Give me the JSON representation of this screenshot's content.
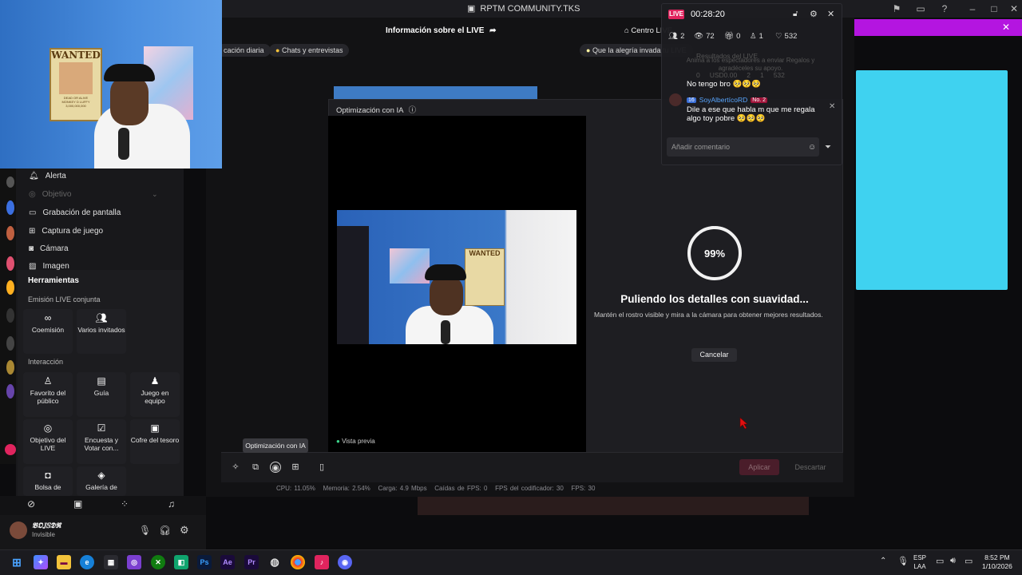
{
  "window": {
    "title": "RPTM COMMUNITY.TKS"
  },
  "studio": {
    "live_info_label": "Información sobre el LIVE",
    "centro_live_label": "Centro LIVE",
    "chips": [
      "cación diaria",
      "Chats y entrevistas",
      "Que la alegría invada tu LIVE"
    ]
  },
  "webcam": {
    "poster_text": "WANTED",
    "poster_sub": "DEAD OR ALIVE",
    "poster_name": "MONKEY D LUFFY",
    "poster_bounty": "3,000,000,000"
  },
  "left_panel": {
    "sources": [
      "Alerta",
      "Objetivo",
      "Grabación de pantalla",
      "Captura de juego",
      "Cámara",
      "Imagen"
    ],
    "tools_title": "Herramientas",
    "joint_label": "Emisión LIVE conjunta",
    "joint_tools": [
      "Coemisión",
      "Varios invitados"
    ],
    "interaction_label": "Interacción",
    "interaction_tools": [
      "Favorito del público",
      "Guía",
      "Juego en equipo",
      "Objetivo del LIVE",
      "Encuesta y Votar con...",
      "Cofre del tesoro",
      "Bolsa de",
      "Galería de"
    ]
  },
  "modal": {
    "header": "Optimización con IA",
    "progress_text": "99%",
    "progress_value": 0.99,
    "status_title": "Puliendo los detalles con suavidad...",
    "status_desc": "Mantén el rostro visible y mira a la cámara para obtener mejores resultados.",
    "cancel_label": "Cancelar",
    "preview_label": "Vista previa",
    "apply_label": "Aplicar",
    "discard_label": "Descartar",
    "tooltip": "Optimización con IA"
  },
  "stats_bar": {
    "cpu": "CPU: 11.05%",
    "memoria": "Memoria: 2.54%",
    "carga": "Carga: 4.9 Mbps",
    "caidas": "Caídas de FPS: 0",
    "fps_cod": "FPS del codificador: 30",
    "fps": "FPS: 30"
  },
  "chat": {
    "live_badge": "LIVE",
    "timer": "00:28:20",
    "stats": {
      "users": "2",
      "views": "72",
      "gifts": "0",
      "followers": "1",
      "likes": "532"
    },
    "results_title": "Resultados del LIVE",
    "results_desc": "Anima a los espectadores a enviar Regalos y agradéceles su apoyo.",
    "results_row": {
      "coins": "0",
      "usd": "USD0.00",
      "users": "2",
      "follows": "1",
      "likes": "532"
    },
    "msg1": "No tengo bro 🥺🥺🥺",
    "msg2_level": "16",
    "msg2_user": "SoyAlbertícoRD",
    "msg2_rank": "No. 2",
    "msg2_text": "Dile a ese que habla m que me regala algo toy pobre 🥺🥺🥺",
    "comment_placeholder": "Añadir comentario"
  },
  "discord_user": {
    "name": "𝕭𝕺𝕁𝕊𝕯𝕽",
    "status": "Invisible"
  },
  "taskbar": {
    "lang": "ESP",
    "lang_sub": "LAA",
    "time": "8:52 PM",
    "date": "1/10/2026"
  },
  "colors": {
    "accent": "#e0245e",
    "pink": "#b415e0",
    "cyan": "#3fd2f0"
  }
}
